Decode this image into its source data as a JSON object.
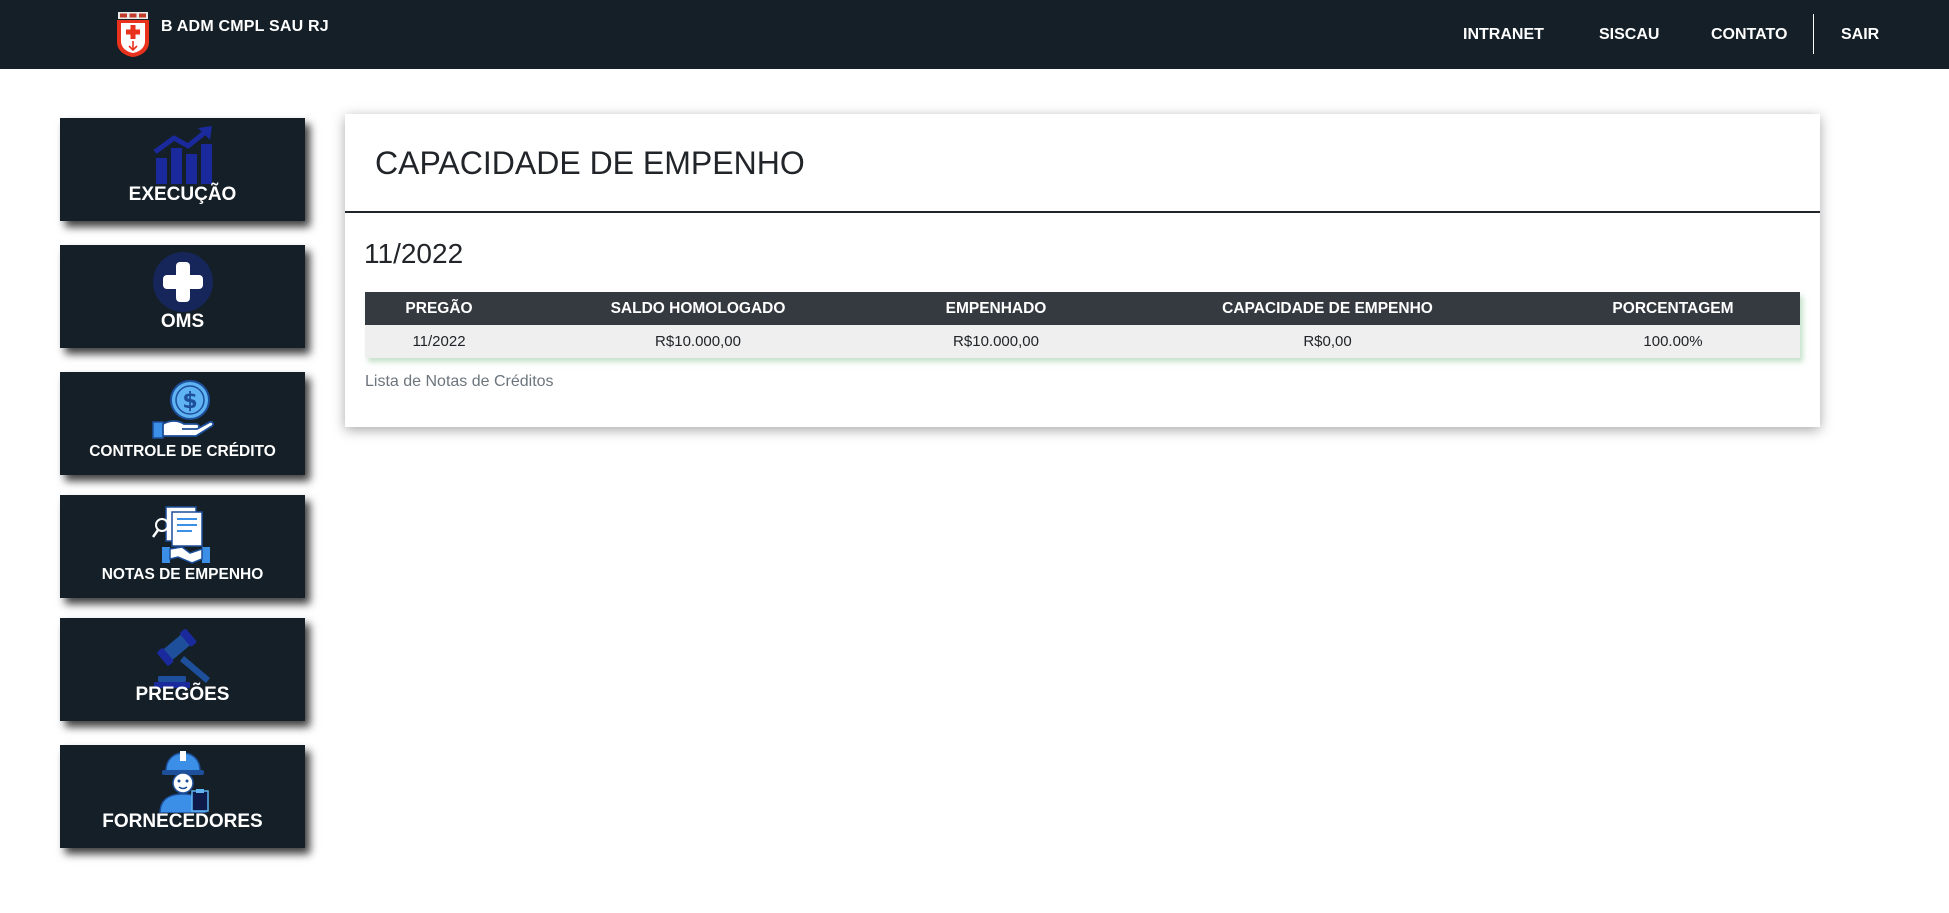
{
  "navbar": {
    "brand_title": "B ADM CMPL SAU RJ",
    "brand_logo_icon": "crest-red-cross-icon",
    "links": [
      "INTRANET",
      "SISCAU",
      "CONTATO",
      "SAIR"
    ]
  },
  "sidebar": {
    "items": [
      {
        "label": "EXECUÇÃO",
        "icon": "chart-growth-icon"
      },
      {
        "label": "OMS",
        "icon": "medical-cross-icon"
      },
      {
        "label": "CONTROLE DE CRÉDITO",
        "icon": "hand-coin-icon"
      },
      {
        "label": "NOTAS DE EMPENHO",
        "icon": "documents-handshake-icon"
      },
      {
        "label": "PREGÕES",
        "icon": "gavel-icon"
      },
      {
        "label": "FORNECEDORES",
        "icon": "worker-clipboard-icon"
      }
    ]
  },
  "main": {
    "title": "CAPACIDADE DE EMPENHO",
    "period": "11/2022",
    "table": {
      "headers": [
        "PREGÃO",
        "SALDO HOMOLOGADO",
        "EMPENHADO",
        "CAPACIDADE DE EMPENHO",
        "PORCENTAGEM"
      ],
      "rows": [
        [
          "11/2022",
          "R$10.000,00",
          "R$10.000,00",
          "R$0,00",
          "100.00%"
        ]
      ]
    },
    "link_label": "Lista de Notas de Créditos"
  },
  "colors": {
    "navbar_bg": "#141f27",
    "tile_bg": "#141f27",
    "table_header_bg": "#343a40",
    "table_row_bg": "#efefef",
    "icon_blue": "#3b8fe6",
    "icon_navy": "#1a2a9c",
    "crest_red": "#e8321e"
  }
}
